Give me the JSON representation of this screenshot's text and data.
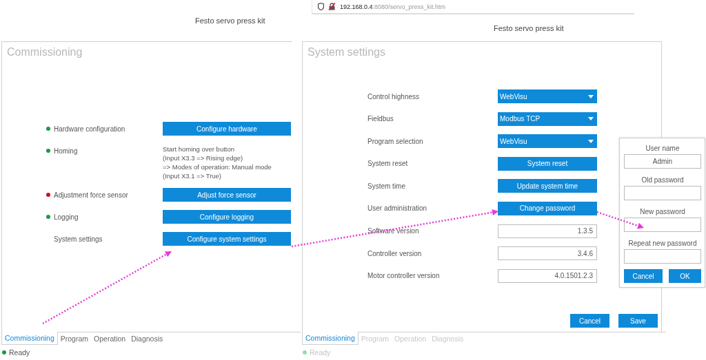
{
  "commissioning_screen": {
    "app_title": "Festo servo press kit",
    "panel_title": "Commissioning",
    "rows": [
      {
        "kind": "button",
        "label": "Hardware configuration",
        "color": "#1a9a48",
        "button": "Configure hardware"
      },
      {
        "kind": "note",
        "label": "Homing",
        "color": "#1a9a48",
        "note_lines": [
          "Start homing over button",
          "(Input X3.3 => Rising edge)",
          "=> Modes of operation: Manual mode",
          "(Input X3.1 => True)"
        ]
      },
      {
        "kind": "button",
        "label": "Adjustment force sensor",
        "color": "#c8102e",
        "button": "Adjust force sensor"
      },
      {
        "kind": "button",
        "label": "Logging",
        "color": "#1a9a48",
        "button": "Configure logging"
      },
      {
        "kind": "button",
        "label": "System settings",
        "button": "Configure system settings"
      }
    ],
    "tabs": [
      {
        "label": "Commissioning",
        "selected": true,
        "disabled": false
      },
      {
        "label": "Program",
        "selected": false,
        "disabled": false
      },
      {
        "label": "Operation",
        "selected": false,
        "disabled": false
      },
      {
        "label": "Diagnosis",
        "selected": false,
        "disabled": false
      }
    ],
    "status_bar": {
      "text": "Ready",
      "dimmed": false
    }
  },
  "system_settings_screen": {
    "address_bar": {
      "host": "192.168.0.4",
      "path": ":8080/servo_press_kit.htm"
    },
    "app_title": "Festo servo press kit",
    "panel_title": "System settings",
    "rows": [
      {
        "kind": "dropdown",
        "label": "Control highness",
        "value": "WebVisu"
      },
      {
        "kind": "dropdown",
        "label": "Fieldbus",
        "value": "Modbus TCP"
      },
      {
        "kind": "dropdown",
        "label": "Program selection",
        "value": "WebVisu"
      },
      {
        "kind": "button",
        "label": "System reset",
        "value": "System reset"
      },
      {
        "kind": "button",
        "label": "System time",
        "value": "Update system time"
      },
      {
        "kind": "button",
        "label": "User administration",
        "value": "Change password"
      },
      {
        "kind": "readonly",
        "label": "Software version",
        "value": "1.3.5"
      },
      {
        "kind": "readonly",
        "label": "Controller version",
        "value": "3.4.6"
      },
      {
        "kind": "readonly",
        "label": "Motor controller version",
        "value": "4.0.1501.2.3"
      }
    ],
    "footer_buttons": [
      "Cancel",
      "Save"
    ],
    "tabs": [
      {
        "label": "Commissioning",
        "selected": true,
        "disabled": false
      },
      {
        "label": "Program",
        "selected": false,
        "disabled": true
      },
      {
        "label": "Operation",
        "selected": false,
        "disabled": true
      },
      {
        "label": "Diagnosis",
        "selected": false,
        "disabled": true
      }
    ],
    "status_bar": {
      "text": "Ready",
      "dimmed": true
    }
  },
  "password_dialog": {
    "fields": [
      {
        "label": "User name",
        "value": "Admin"
      },
      {
        "label": "Old password"
      },
      {
        "label": "New password"
      },
      {
        "label": "Repeat new password"
      }
    ],
    "buttons": [
      "Cancel",
      "OK"
    ]
  }
}
